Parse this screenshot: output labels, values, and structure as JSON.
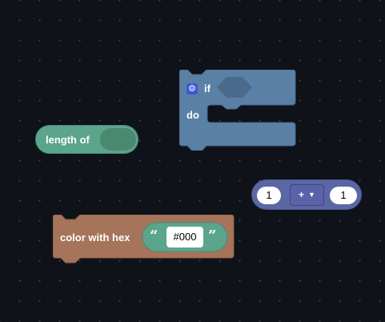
{
  "workspace": {
    "background_color": "#0f1219",
    "grid_dot_color": "#3c4150"
  },
  "blocks": {
    "length_of": {
      "label": "length of",
      "color": "#5ba58c",
      "input_color": "#4a8870"
    },
    "if_do": {
      "label_if": "if",
      "label_do": "do",
      "color": "#5b80a5",
      "input_color": "#4a6a8c",
      "icon": "gear-icon"
    },
    "math_arithmetic": {
      "value_a": "1",
      "operator": "+",
      "value_b": "1",
      "color": "#5b67a5",
      "icon": "caret-down-icon"
    },
    "color_hex": {
      "label": "color with hex",
      "text_value": "#000",
      "open_quote": "“",
      "close_quote": "”",
      "color": "#a5745b",
      "text_block_color": "#5ba58c"
    }
  }
}
